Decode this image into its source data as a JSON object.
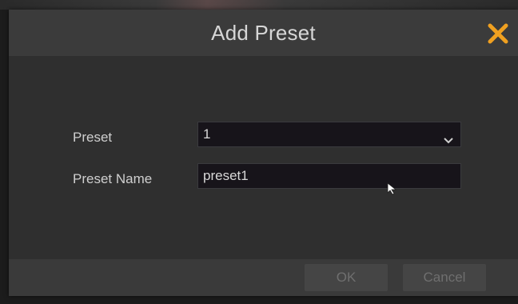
{
  "dialog": {
    "title": "Add Preset",
    "close_icon": "close-icon",
    "accent_color": "#f0a020"
  },
  "form": {
    "preset_label": "Preset",
    "preset_value": "1",
    "preset_name_label": "Preset Name",
    "preset_name_value": "preset1"
  },
  "footer": {
    "ok_label": "OK",
    "cancel_label": "Cancel"
  }
}
